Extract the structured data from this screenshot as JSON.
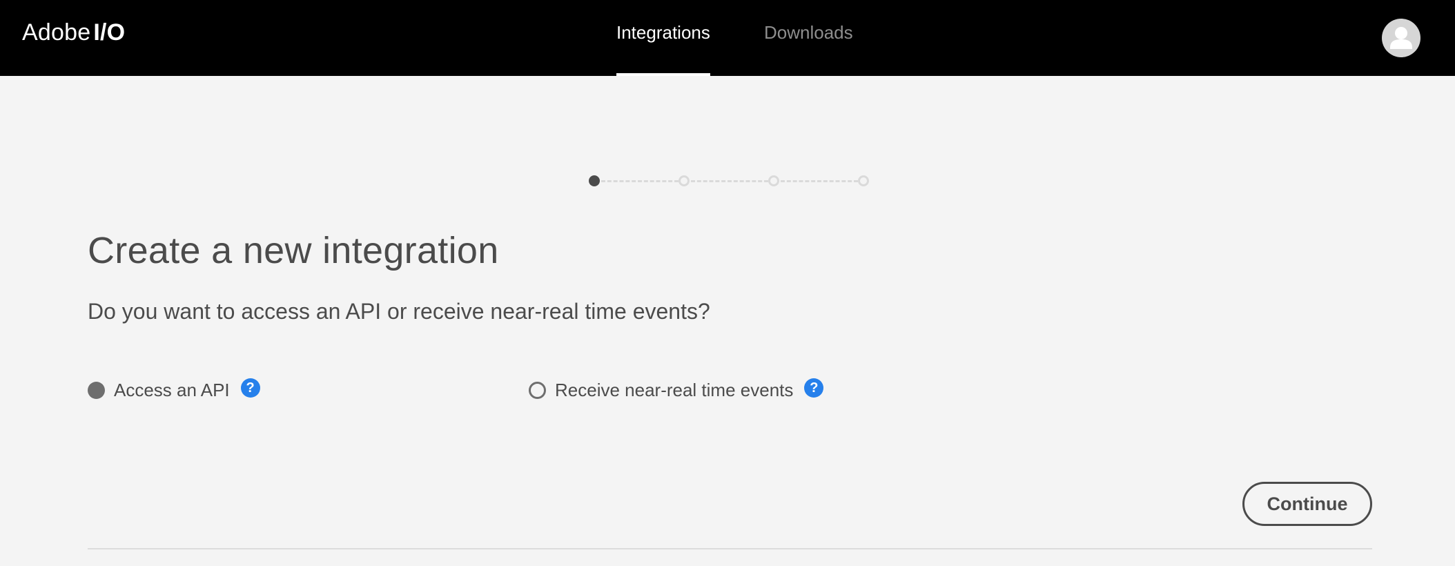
{
  "header": {
    "brand_prefix": "Adobe",
    "brand_suffix": "I/O",
    "tabs": [
      {
        "label": "Integrations",
        "active": true
      },
      {
        "label": "Downloads",
        "active": false
      }
    ],
    "avatar_icon": "user-avatar-icon"
  },
  "stepper": {
    "total_steps": 4,
    "current_step": 1
  },
  "main": {
    "title": "Create a new integration",
    "question": "Do you want to access an API or receive near-real time events?",
    "options": [
      {
        "label": "Access an API",
        "selected": true,
        "help_icon": "question-mark-icon",
        "help_glyph": "?"
      },
      {
        "label": "Receive near-real time events",
        "selected": false,
        "help_icon": "question-mark-icon",
        "help_glyph": "?"
      }
    ],
    "continue_label": "Continue"
  },
  "colors": {
    "header_bg": "#000000",
    "page_bg": "#f4f4f4",
    "text": "#4b4b4b",
    "help_blue": "#2680eb"
  }
}
